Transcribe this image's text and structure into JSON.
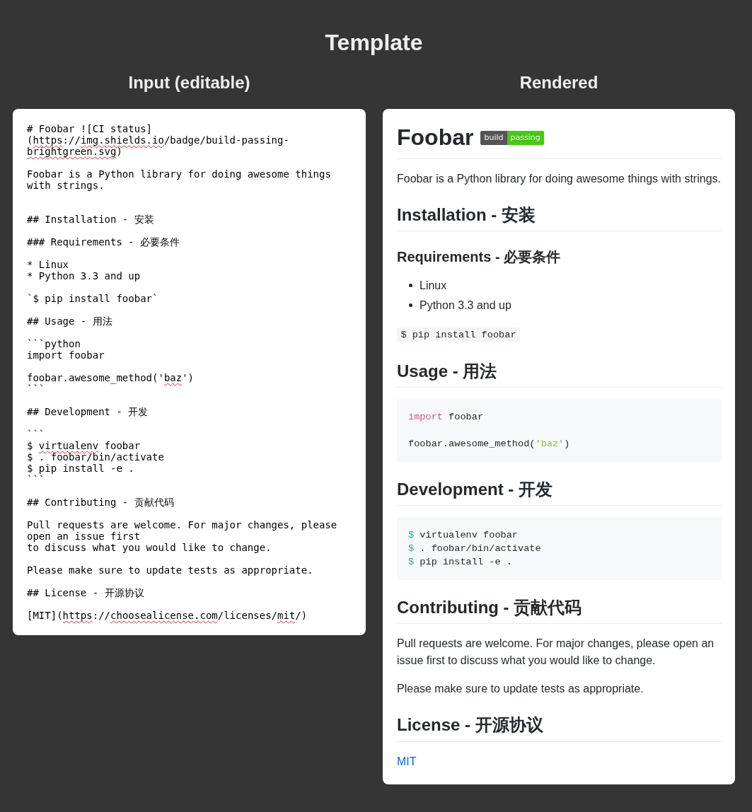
{
  "title": "Template",
  "editor": {
    "heading": "Input (editable)",
    "segments": [
      {
        "text": "# Foobar ![CI status](",
        "misspelled": false
      },
      {
        "text": "https",
        "misspelled": true
      },
      {
        "text": "://",
        "misspelled": false
      },
      {
        "text": "img.shields.io",
        "misspelled": true
      },
      {
        "text": "/badge/build-passing-",
        "misspelled": false
      },
      {
        "text": "brightgreen.svg",
        "misspelled": true
      },
      {
        "text": ")\n\nFoobar is a Python library for doing awesome things with strings.\n\n\n## Installation - 安装\n\n### Requirements - 必要条件\n\n* Linux\n* Python 3.3 and up\n\n`$ pip install foobar`\n\n## Usage - 用法\n\n```python\nimport foobar\n\nfoobar.awesome_method('",
        "misspelled": false
      },
      {
        "text": "baz",
        "misspelled": true
      },
      {
        "text": "')\n```\n\n## Development - 开发\n\n```\n$ ",
        "misspelled": false
      },
      {
        "text": "virtualenv",
        "misspelled": true
      },
      {
        "text": " foobar\n$ . foobar/bin/activate\n$ pip install -e .\n```\n\n## Contributing - 贡献代码\n\nPull requests are welcome. For major changes, please open an issue first\nto discuss what you would like to change.\n\nPlease make sure to update tests as appropriate.\n\n## License - 开源协议\n\n[MIT](",
        "misspelled": false
      },
      {
        "text": "https",
        "misspelled": true
      },
      {
        "text": "://",
        "misspelled": false
      },
      {
        "text": "choosealicense.com",
        "misspelled": true
      },
      {
        "text": "/licenses/",
        "misspelled": false
      },
      {
        "text": "mit",
        "misspelled": true
      },
      {
        "text": "/)",
        "misspelled": false
      }
    ]
  },
  "preview": {
    "heading": "Rendered",
    "title": "Foobar",
    "badge": {
      "label": "build",
      "message": "passing"
    },
    "blocks": [
      {
        "kind": "paragraph",
        "text": "Foobar is a Python library for doing awesome things with strings."
      },
      {
        "kind": "h2",
        "text": "Installation - 安装"
      },
      {
        "kind": "h3",
        "text": "Requirements - 必要条件"
      },
      {
        "kind": "list",
        "items": [
          "Linux",
          "Python 3.3 and up"
        ]
      },
      {
        "kind": "inline_code",
        "text": "$ pip install foobar"
      },
      {
        "kind": "h2",
        "text": "Usage - 用法"
      },
      {
        "kind": "code_block",
        "tokens": [
          {
            "kind": "keyword",
            "text": "import"
          },
          {
            "kind": "plain",
            "text": " foobar\n\nfoobar.awesome_method("
          },
          {
            "kind": "string",
            "text": "'baz'"
          },
          {
            "kind": "plain",
            "text": ")"
          }
        ]
      },
      {
        "kind": "h2",
        "text": "Development - 开发"
      },
      {
        "kind": "code_block",
        "tokens": [
          {
            "kind": "prompt",
            "text": "$"
          },
          {
            "kind": "plain",
            "text": " virtualenv foobar\n"
          },
          {
            "kind": "prompt",
            "text": "$"
          },
          {
            "kind": "plain",
            "text": " . foobar/bin/activate\n"
          },
          {
            "kind": "prompt",
            "text": "$"
          },
          {
            "kind": "plain",
            "text": " pip install -e ."
          }
        ]
      },
      {
        "kind": "h2",
        "text": "Contributing - 贡献代码"
      },
      {
        "kind": "paragraph",
        "text": "Pull requests are welcome. For major changes, please open an issue first to discuss what you would like to change."
      },
      {
        "kind": "paragraph",
        "text": "Please make sure to update tests as appropriate."
      },
      {
        "kind": "h2",
        "text": "License - 开源协议"
      },
      {
        "kind": "link",
        "text": "MIT"
      }
    ]
  }
}
